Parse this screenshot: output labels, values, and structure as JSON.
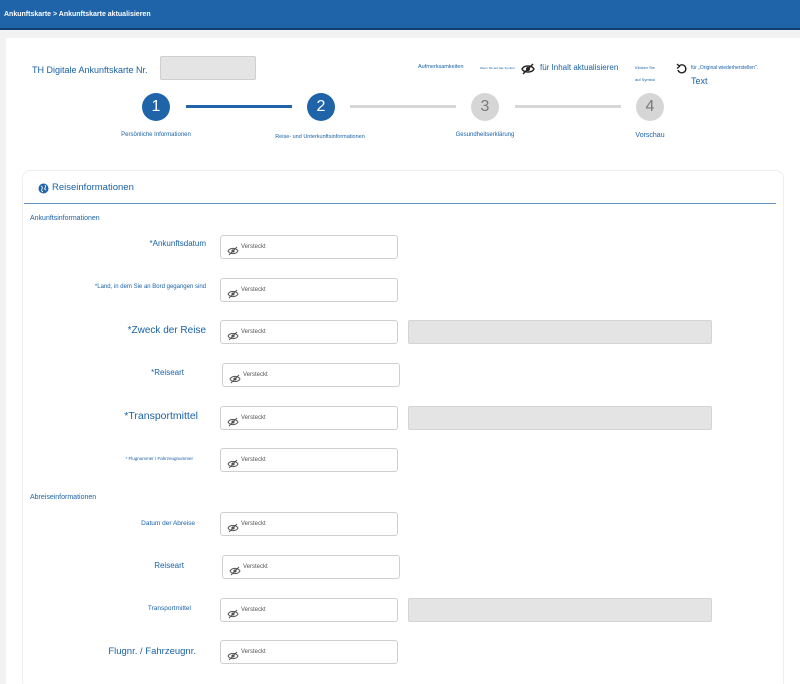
{
  "breadcrumb": "Ankunftskarte > Ankunftskarte aktualisieren",
  "header": {
    "card_number_label": "TH Digitale Ankunftskarte Nr.",
    "attention_label": "Aufmerksamkeiten",
    "tiny_note_1": "Wenn Sie auf das Symbol",
    "hide_update_label": "für Inhalt aktualisieren",
    "tiny_note_2a": "Klicken Sie",
    "tiny_note_2b": "auf Symbol",
    "restore_label": "für „Original wiederherstellen\".",
    "text_link": "Text"
  },
  "steps": [
    {
      "num": "1",
      "label": "Persönliche Informationen",
      "state": "active"
    },
    {
      "num": "2",
      "label": "Reise- und Unterkunftsinformationen",
      "state": "active"
    },
    {
      "num": "3",
      "label": "Gesundheitserklärung",
      "state": "inactive"
    },
    {
      "num": "4",
      "label": "Vorschau",
      "state": "inactive"
    }
  ],
  "section": {
    "title": "Reiseinformationen",
    "arrival_heading": "Ankunftsinformationen",
    "departure_heading": "Abreiseinformationen"
  },
  "arrival_fields": [
    {
      "label": "*Ankunftsdatum",
      "value": "Versteckt"
    },
    {
      "label": "*Land, in dem Sie an Bord gegangen sind",
      "value": "Versteckt"
    },
    {
      "label": "*Zweck der Reise",
      "value": "Versteckt"
    },
    {
      "label": "*Reiseart",
      "value": "Versteckt"
    },
    {
      "label": "*Transportmittel",
      "value": "Versteckt"
    },
    {
      "label": "* Flugnummer / Fahrzeugnummer",
      "value": "Versteckt"
    }
  ],
  "departure_fields": [
    {
      "label": "Datum der Abreise",
      "value": "Versteckt"
    },
    {
      "label": "Reiseart",
      "value": "Versteckt"
    },
    {
      "label": "Transportmittel",
      "value": "Versteckt"
    },
    {
      "label": "Flugnr. / Fahrzeugnr.",
      "value": "Versteckt"
    }
  ],
  "colors": {
    "primary": "#1f63a8",
    "inactive": "#d6d6d6",
    "field_grey": "#e4e4e4"
  }
}
